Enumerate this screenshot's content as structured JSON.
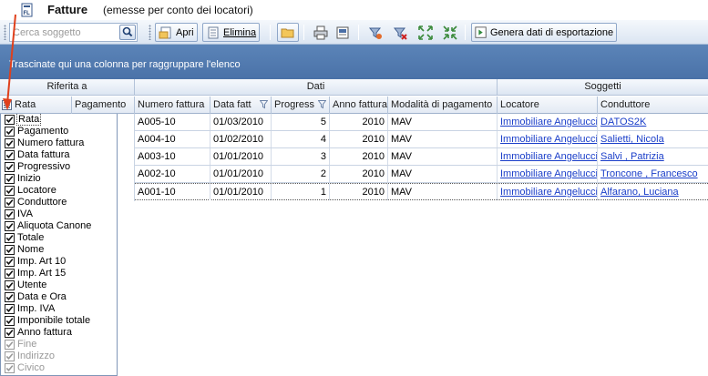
{
  "window": {
    "app_icon_label": "FL",
    "title": "Fatture",
    "subtitle": "(emesse per conto dei locatori)"
  },
  "toolbar": {
    "search_placeholder": "Cerca soggetto",
    "open_label": "Apri",
    "delete_label": "Elimina",
    "export_label": "Genera dati di esportazione"
  },
  "group_panel": {
    "hint": "Trascinate qui una colonna per raggruppare l'elenco"
  },
  "grid": {
    "bands": [
      "Riferita a",
      "Dati",
      "Soggetti"
    ],
    "columns": [
      "Rata",
      "Pagamento",
      "Numero fattura",
      "Data fatt",
      "Progress",
      "Anno fattura",
      "Modalità di pagamento",
      "Locatore",
      "Conduttore"
    ],
    "rows": [
      {
        "numero": "A005-10",
        "data": "01/03/2010",
        "progressivo": "5",
        "anno": "2010",
        "modalita": "MAV",
        "locatore": "Immobiliare Angelucci",
        "conduttore": "DATOS2K"
      },
      {
        "numero": "A004-10",
        "data": "01/02/2010",
        "progressivo": "4",
        "anno": "2010",
        "modalita": "MAV",
        "locatore": "Immobiliare Angelucci",
        "conduttore": "Salietti, Nicola"
      },
      {
        "numero": "A003-10",
        "data": "01/01/2010",
        "progressivo": "3",
        "anno": "2010",
        "modalita": "MAV",
        "locatore": "Immobiliare Angelucci",
        "conduttore": "Salvi , Patrizia"
      },
      {
        "numero": "A002-10",
        "data": "01/01/2010",
        "progressivo": "2",
        "anno": "2010",
        "modalita": "MAV",
        "locatore": "Immobiliare Angelucci",
        "conduttore": "Troncone , Francesco"
      },
      {
        "numero": "A001-10",
        "data": "01/01/2010",
        "progressivo": "1",
        "anno": "2010",
        "modalita": "MAV",
        "locatore": "Immobiliare Angelucci",
        "conduttore": "Alfarano, Luciana"
      }
    ]
  },
  "column_chooser": {
    "items": [
      {
        "label": "Rata",
        "checked": true,
        "enabled": true
      },
      {
        "label": "Pagamento",
        "checked": true,
        "enabled": true
      },
      {
        "label": "Numero fattura",
        "checked": true,
        "enabled": true
      },
      {
        "label": "Data fattura",
        "checked": true,
        "enabled": true
      },
      {
        "label": "Progressivo",
        "checked": true,
        "enabled": true
      },
      {
        "label": "Inizio",
        "checked": true,
        "enabled": true
      },
      {
        "label": "Locatore",
        "checked": true,
        "enabled": true
      },
      {
        "label": "Conduttore",
        "checked": true,
        "enabled": true
      },
      {
        "label": "IVA",
        "checked": true,
        "enabled": true
      },
      {
        "label": "Aliquota Canone",
        "checked": true,
        "enabled": true
      },
      {
        "label": "Totale",
        "checked": true,
        "enabled": true
      },
      {
        "label": "Nome",
        "checked": true,
        "enabled": true
      },
      {
        "label": "Imp. Art 10",
        "checked": true,
        "enabled": true
      },
      {
        "label": "Imp. Art 15",
        "checked": true,
        "enabled": true
      },
      {
        "label": "Utente",
        "checked": true,
        "enabled": true
      },
      {
        "label": "Data e Ora",
        "checked": true,
        "enabled": true
      },
      {
        "label": "Imp. IVA",
        "checked": true,
        "enabled": true
      },
      {
        "label": "Imponibile totale",
        "checked": true,
        "enabled": true
      },
      {
        "label": "Anno fattura",
        "checked": true,
        "enabled": true
      },
      {
        "label": "Fine",
        "checked": true,
        "enabled": false
      },
      {
        "label": "Indirizzo",
        "checked": true,
        "enabled": false
      },
      {
        "label": "Civico",
        "checked": true,
        "enabled": false
      }
    ]
  },
  "colors": {
    "group_panel": "#5079ae",
    "link": "#1a3ec9",
    "annotation_arrow": "#e0401c"
  }
}
